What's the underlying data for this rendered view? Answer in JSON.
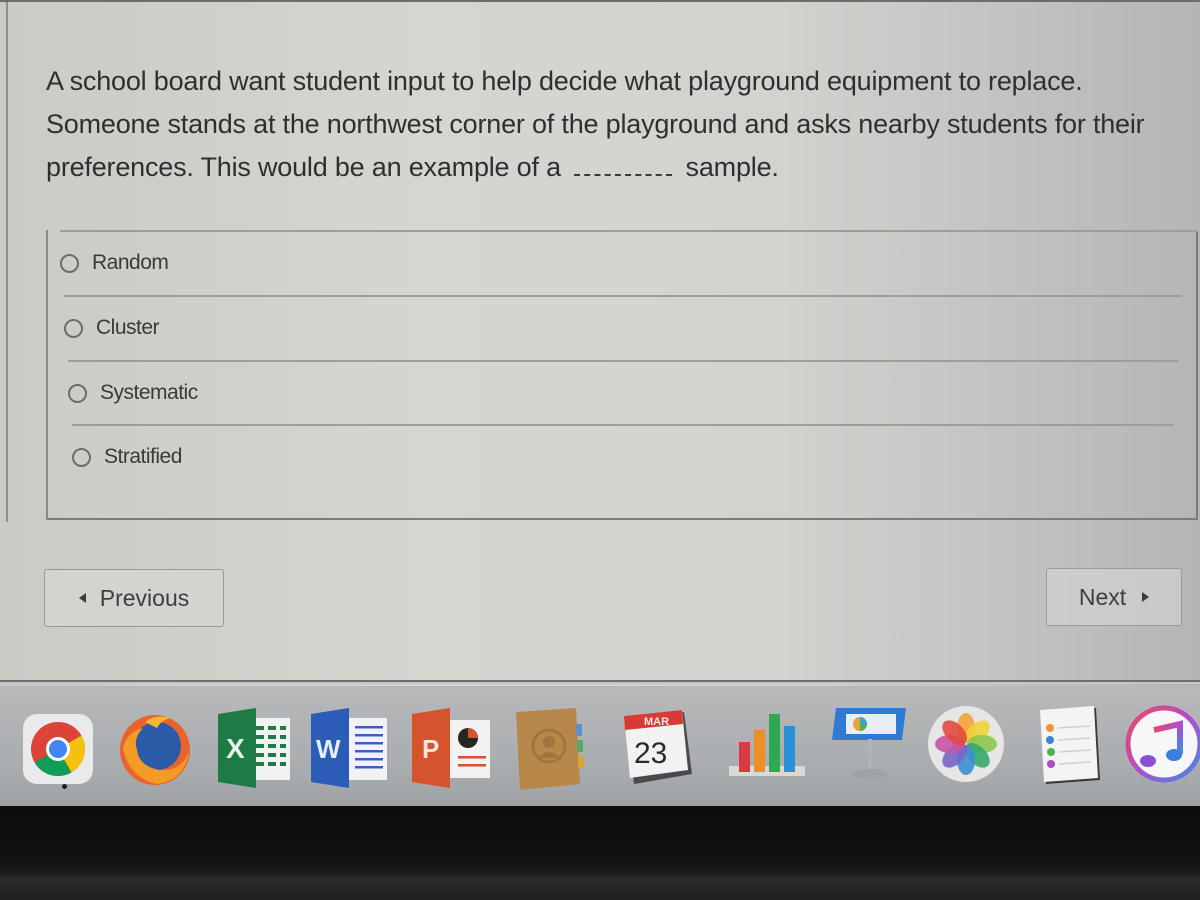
{
  "question": {
    "text_before_blank": "A school board want student input to help decide what playground equipment to replace. Someone stands at the northwest corner of the playground and asks nearby students for their preferences. This would be an example of a",
    "line1": "A school board want student input to help decide what playground equipment to replace.",
    "line2": "Someone stands at the northwest corner of the playground and asks nearby students for their",
    "line3_before_blank": "preferences. This would be an example of a",
    "line3_after_blank": "sample."
  },
  "answers": [
    {
      "label": "Random",
      "selected": false
    },
    {
      "label": "Cluster",
      "selected": false
    },
    {
      "label": "Systematic",
      "selected": false
    },
    {
      "label": "Stratified",
      "selected": false
    }
  ],
  "navigation": {
    "previous_label": "Previous",
    "next_label": "Next"
  },
  "dock": {
    "apps": [
      {
        "name": "Google Chrome",
        "icon": "chrome-icon",
        "running": true
      },
      {
        "name": "Firefox",
        "icon": "firefox-icon",
        "running": false
      },
      {
        "name": "Microsoft Excel",
        "icon": "excel-icon",
        "letter": "X",
        "running": false
      },
      {
        "name": "Microsoft Word",
        "icon": "word-icon",
        "letter": "W",
        "running": false
      },
      {
        "name": "Microsoft PowerPoint",
        "icon": "powerpoint-icon",
        "letter": "P",
        "running": false
      },
      {
        "name": "Contacts",
        "icon": "contacts-icon",
        "running": false
      },
      {
        "name": "Calendar",
        "icon": "calendar-icon",
        "month": "MAR",
        "day": "23",
        "running": false
      },
      {
        "name": "Numbers",
        "icon": "numbers-icon",
        "running": false
      },
      {
        "name": "Keynote",
        "icon": "keynote-icon",
        "running": false
      },
      {
        "name": "Photos",
        "icon": "photos-icon",
        "running": false
      },
      {
        "name": "Reminders",
        "icon": "reminders-icon",
        "running": false
      },
      {
        "name": "iTunes",
        "icon": "itunes-icon",
        "running": false
      }
    ]
  },
  "colors": {
    "excel": "#1e7b45",
    "word": "#2b5cb8",
    "powerpoint": "#d5532d",
    "calendar_red": "#d83a36",
    "contacts": "#b8874a"
  }
}
